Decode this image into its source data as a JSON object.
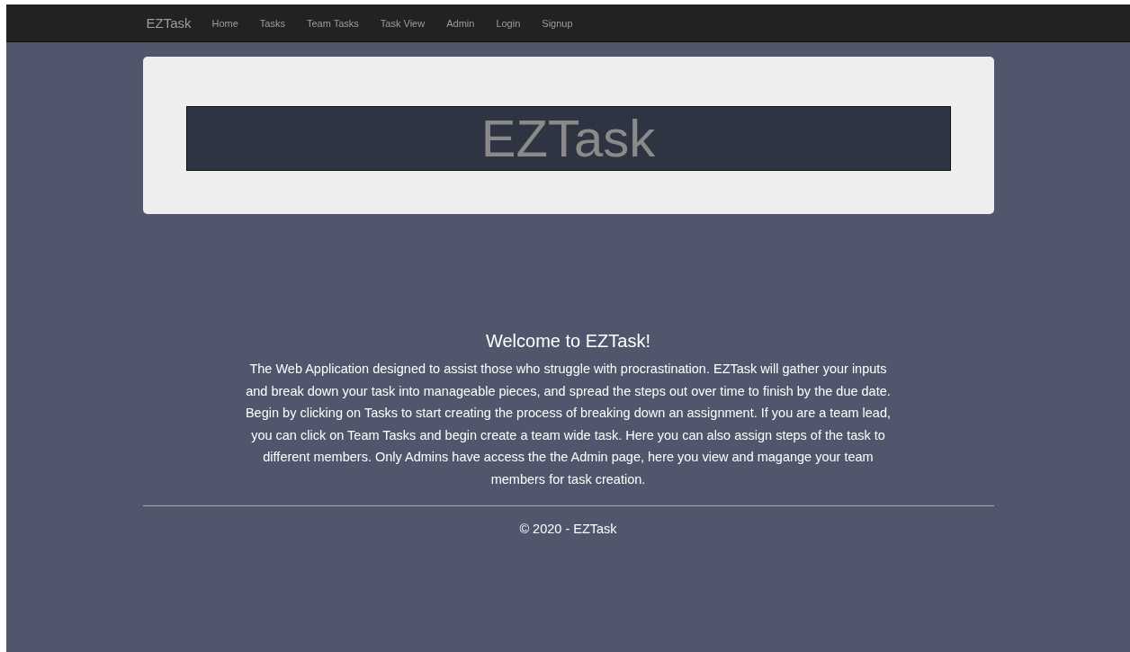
{
  "navbar": {
    "brand": "EZTask",
    "links": [
      {
        "label": "Home"
      },
      {
        "label": "Tasks"
      },
      {
        "label": "Team Tasks"
      },
      {
        "label": "Task View"
      },
      {
        "label": "Admin"
      },
      {
        "label": "Login"
      },
      {
        "label": "Signup"
      }
    ]
  },
  "jumbotron": {
    "banner": "EZTask"
  },
  "welcome": {
    "heading": "Welcome to EZTask!",
    "paragraphs": [
      "The Web Application designed to assist those who struggle with procrastination. EZTask will gather your inputs and break down your task into manageable pieces, and spread the steps out over time to finish by the due date.",
      "Begin by clicking on Tasks to start creating the process of breaking down an assignment. If you are a team lead, you can click on Team Tasks and begin create a team wide task. Here you can also assign steps of the task to different members. Only Admins have access the the Admin page, here you view and magange your team members for task creation."
    ]
  },
  "footer": {
    "text": "© 2020 - EZTask"
  }
}
